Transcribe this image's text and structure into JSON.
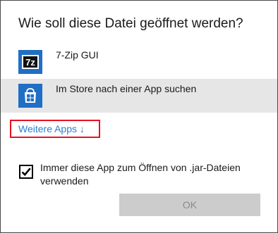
{
  "dialog": {
    "title": "Wie soll diese Datei geöffnet werden?"
  },
  "apps": [
    {
      "label": "7-Zip GUI",
      "icon": "7zip-icon"
    },
    {
      "label": "Im Store nach einer App suchen",
      "icon": "store-icon"
    }
  ],
  "more_apps": {
    "label": "Weitere Apps",
    "arrow": "↓"
  },
  "always_use": {
    "label": "Immer diese App zum Öffnen von .jar-Dateien verwenden",
    "checked": true
  },
  "ok_button": {
    "label": "OK",
    "enabled": false
  },
  "colors": {
    "accent": "#2a7fd4",
    "highlight_border": "#e81123",
    "selected_row": "#e6e6e6",
    "app_tile": "#1f6fc4"
  }
}
